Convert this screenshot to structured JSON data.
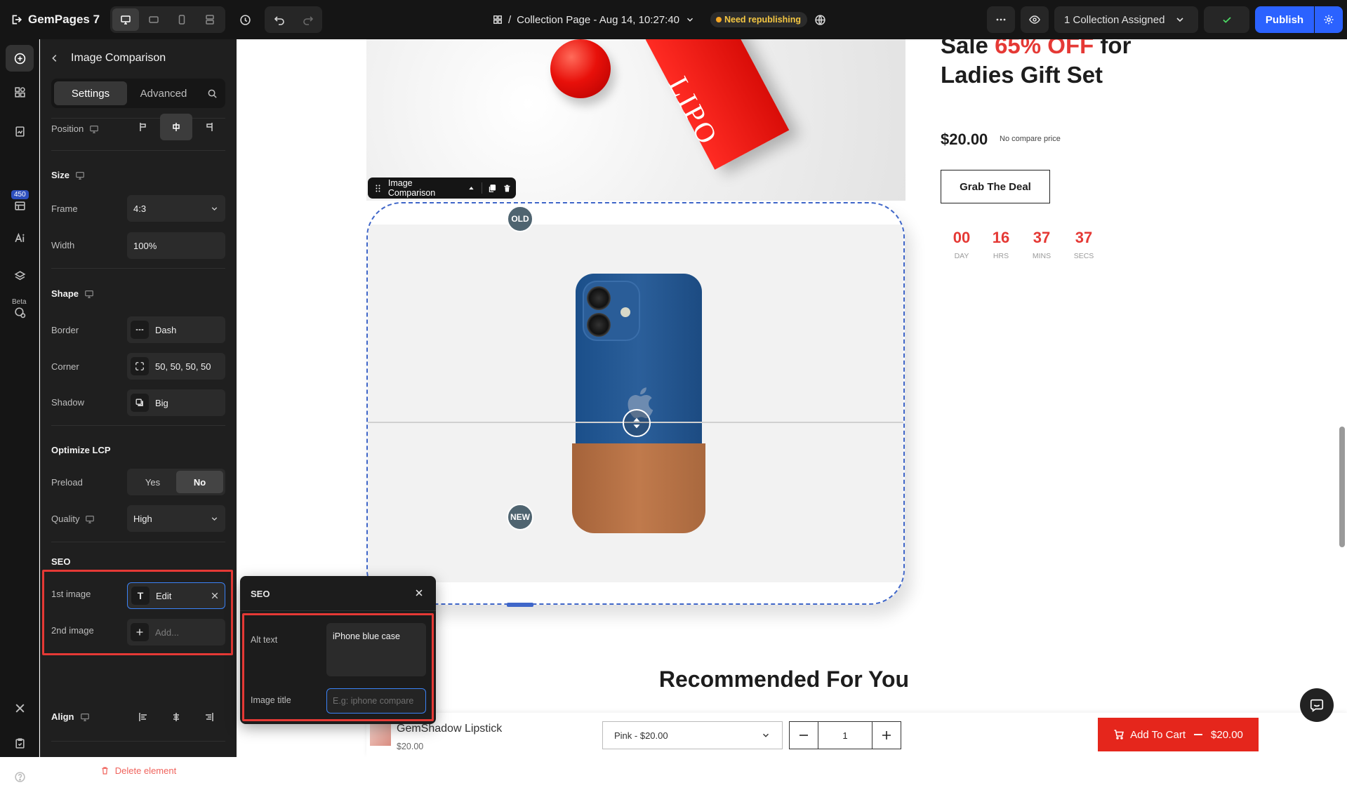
{
  "app": {
    "name": "GemPages 7"
  },
  "page": {
    "title": "Collection Page - Aug 14, 10:27:40",
    "status": "Need republishing",
    "collection_label": "1 Collection Assigned",
    "publish_label": "Publish"
  },
  "rail": {
    "count": "450",
    "beta": "Beta"
  },
  "panel": {
    "title": "Image Comparison",
    "tabs": {
      "settings": "Settings",
      "advanced": "Advanced"
    },
    "position_label": "Position",
    "size_title": "Size",
    "frame_label": "Frame",
    "frame_value": "4:3",
    "width_label": "Width",
    "width_value": "100%",
    "shape_title": "Shape",
    "border_label": "Border",
    "border_value": "Dash",
    "corner_label": "Corner",
    "corner_value": "50, 50, 50, 50",
    "shadow_label": "Shadow",
    "shadow_value": "Big",
    "lcp_title": "Optimize LCP",
    "preload_label": "Preload",
    "preload_yes": "Yes",
    "preload_no": "No",
    "quality_label": "Quality",
    "quality_value": "High",
    "seo_title": "SEO",
    "first_image_label": "1st image",
    "first_image_value": "Edit",
    "second_image_label": "2nd image",
    "second_image_placeholder": "Add...",
    "align_title": "Align",
    "delete_label": "Delete element"
  },
  "seo_popover": {
    "title": "SEO",
    "alt_label": "Alt text",
    "alt_value": "iPhone blue case",
    "image_title_label": "Image title",
    "image_title_placeholder": "E.g: iphone compare"
  },
  "canvas": {
    "toolbar_label": "Image Comparison",
    "old_label": "OLD",
    "new_label": "NEW",
    "headline_1": "Sale ",
    "headline_red": "65% OFF",
    "headline_2": " for",
    "headline_3": "Ladies Gift Set",
    "price": "$20.00",
    "compare": "No compare price",
    "cta": "Grab The Deal",
    "countdown": [
      {
        "value": "00",
        "label": "DAY"
      },
      {
        "value": "16",
        "label": "HRS"
      },
      {
        "value": "37",
        "label": "MINS"
      },
      {
        "value": "37",
        "label": "SECS"
      }
    ],
    "recommended": "Recommended For You",
    "product_box_text": "LIPO",
    "sticky": {
      "name": "GemShadow Lipstick",
      "price": "$20.00",
      "variant": "Pink - $20.00",
      "qty": "1",
      "cart_label": "Add To Cart",
      "cart_price": "$20.00"
    }
  },
  "colors": {
    "accent": "#2b62ff",
    "sale_red": "#e53935",
    "highlight": "#e53935",
    "selection": "#3f66c9"
  }
}
